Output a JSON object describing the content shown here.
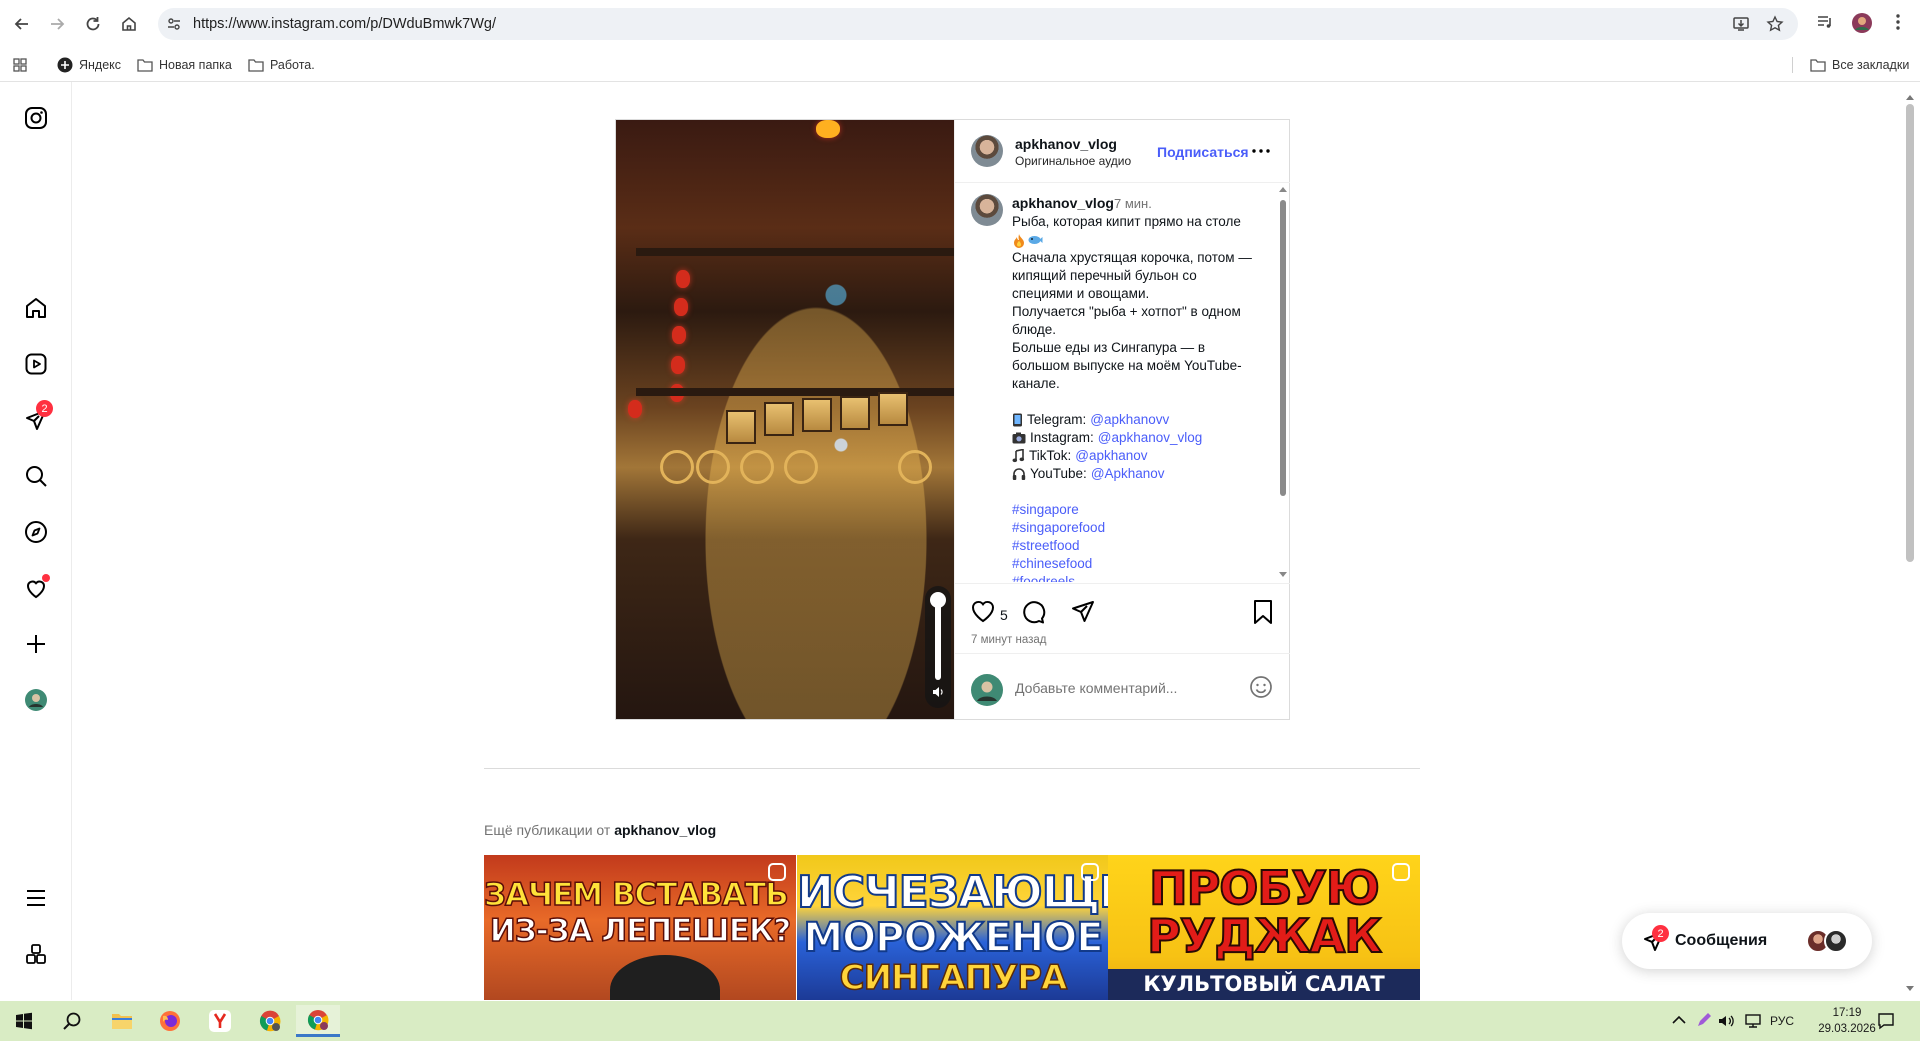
{
  "browser": {
    "url": "https://www.instagram.com/p/DWduBmwk7Wg/",
    "bookmarks": [
      "Яндекс",
      "Новая папка",
      "Работа."
    ],
    "all_bookmarks": "Все закладки"
  },
  "rail": {
    "notifications_badge": "2"
  },
  "post": {
    "author": "apkhanov_vlog",
    "audio": "Оригинальное аудио",
    "follow": "Подписаться",
    "caption_user": "apkhanov_vlog",
    "caption_time": "7 мин.",
    "caption_lines": [
      "Рыба, которая кипит прямо на столе",
      "Сначала хрустящая корочка, потом —",
      "кипящий перечный бульон со",
      "специями и овощами.",
      "Получается \"рыба + хотпот\" в одном",
      "блюде.",
      "Больше еды из Сингапура — в",
      "большом выпуске на моём YouTube-",
      "канале."
    ],
    "socials": [
      {
        "label": "Telegram:",
        "handle": "@apkhanovv",
        "icon": "phone-emoji"
      },
      {
        "label": "Instagram:",
        "handle": "@apkhanov_vlog",
        "icon": "camera-emoji"
      },
      {
        "label": "TikTok:",
        "handle": "@apkhanov",
        "icon": "music-note-emoji"
      },
      {
        "label": "YouTube:",
        "handle": "@Apkhanov",
        "icon": "headphones-emoji"
      }
    ],
    "hashtags": [
      "#singapore",
      "#singaporefood",
      "#streetfood",
      "#chinesefood",
      "#foodreels"
    ],
    "likes": "5",
    "time_ago": "7 минут назад",
    "comment_placeholder": "Добавьте комментарий..."
  },
  "more": {
    "prefix": "Ещё публикации от",
    "user": "apkhanov_vlog",
    "thumbnails": [
      {
        "line1": "ЗАЧЕМ ВСТАВАТЬ РАНО",
        "line2": "ИЗ-ЗА ЛЕПЕШЕК?"
      },
      {
        "line1": "ИСЧЕЗАЮЩЕЕ",
        "line2": "МОРОЖЕНОЕ",
        "line3": "СИНГАПУРА"
      },
      {
        "line1": "ПРОБУЮ",
        "line2": "РУДЖАК",
        "line3": "КУЛЬТОВЫЙ САЛАТ БАЛИ"
      }
    ]
  },
  "messages": {
    "label": "Сообщения",
    "badge": "2"
  },
  "taskbar": {
    "lang": "РУС",
    "time": "17:19",
    "date": "29.03.2026"
  },
  "colors": {
    "ig_link": "#4a5df9",
    "badge": "#ff3040",
    "taskbar": "#d9ecc4"
  }
}
